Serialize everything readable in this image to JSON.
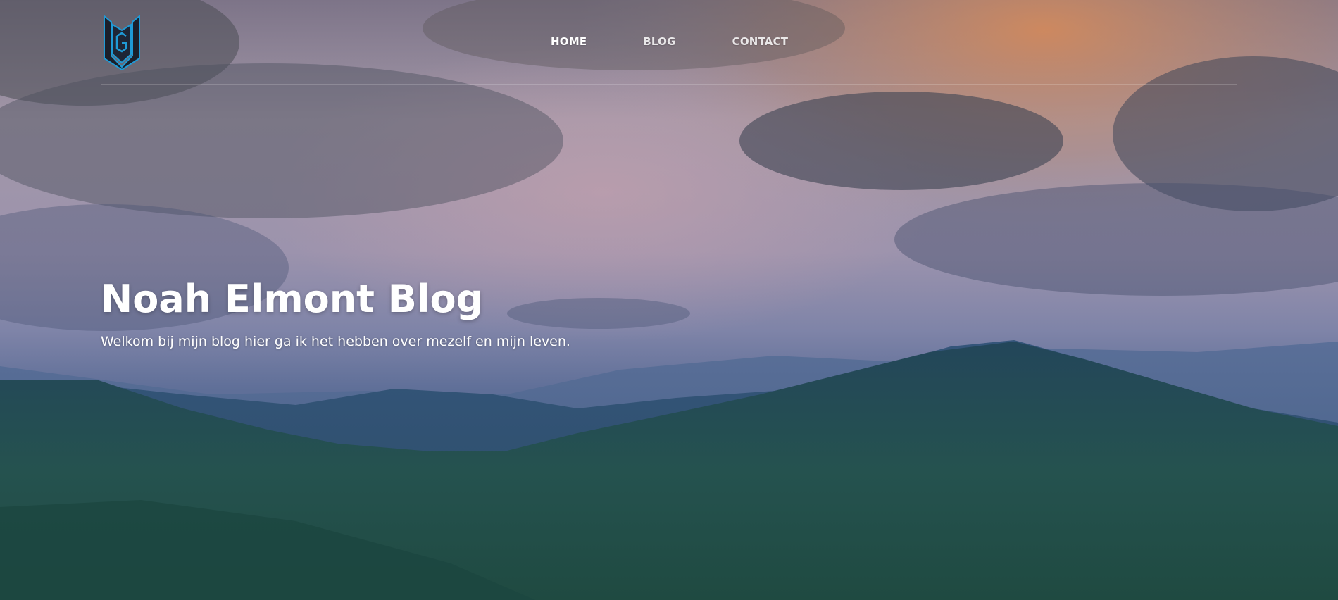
{
  "brand": {
    "logo_icon": "gd-monogram-shield-logo",
    "logo_color": "#1f9ad6"
  },
  "nav": {
    "items": [
      {
        "label": "HOME",
        "active": true
      },
      {
        "label": "BLOG",
        "active": false
      },
      {
        "label": "CONTACT",
        "active": false
      }
    ]
  },
  "hero": {
    "title": "Noah Elmont Blog",
    "subtitle": "Welkom bij mijn blog hier ga ik het hebben over mezelf en mijn leven.",
    "background": "mountain-landscape-cloudy-sky"
  },
  "colors": {
    "text": "#ffffff",
    "accent": "#1f9ad6"
  }
}
